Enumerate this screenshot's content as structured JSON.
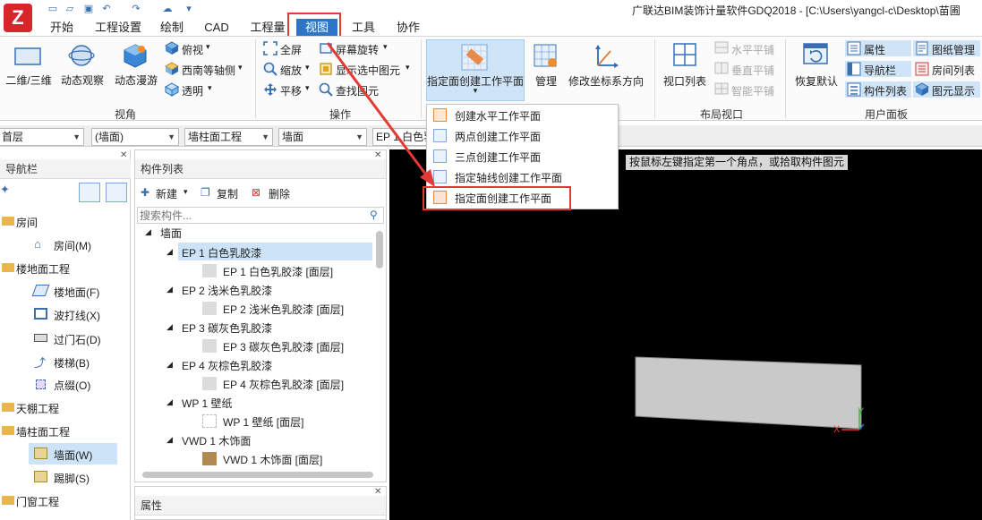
{
  "window": {
    "title": "广联达BIM装饰计量软件GDQ2018 - [C:\\Users\\yangcl-c\\Desktop\\苗圃"
  },
  "menu": {
    "logo": "Z",
    "tabs": [
      "开始",
      "工程设置",
      "绘制",
      "CAD",
      "工程量",
      "视图",
      "工具",
      "协作"
    ],
    "active_tab": "视图"
  },
  "ribbon": {
    "view_angle": {
      "group_label": "视角",
      "btn_2d3d": "二维/三维",
      "btn_dynamic_observe": "动态观察",
      "btn_dynamic_roam": "动态漫游",
      "btn_top_view": "俯视",
      "btn_southwest_axis": "西南等轴侧",
      "btn_transparent": "透明"
    },
    "operation": {
      "group_label": "操作",
      "btn_fullscreen": "全屏",
      "btn_zoom": "缩放",
      "btn_pan": "平移",
      "btn_screen_rotate": "屏幕旋转",
      "btn_show_selected": "显示选中图元",
      "btn_find_element": "查找图元"
    },
    "workplane": {
      "btn_face_workplane": "指定面创建工作平面",
      "btn_manage": "管理",
      "btn_modify_coord": "修改坐标系方向"
    },
    "layout_viewport": {
      "group_label": "布局视口",
      "btn_viewport_list": "视口列表",
      "btn_horizontal_tile": "水平平铺",
      "btn_vertical_tile": "垂直平铺",
      "btn_smart_tile": "智能平铺"
    },
    "user_panel": {
      "group_label": "用户面板",
      "btn_restore_default": "恢复默认",
      "btn_properties": "属性",
      "btn_navbar": "导航栏",
      "btn_component_list": "构件列表",
      "btn_drawing_manage": "图纸管理",
      "btn_room_list": "房间列表",
      "btn_element_display": "图元显示"
    }
  },
  "dropdown": {
    "items": [
      "创建水平工作平面",
      "两点创建工作平面",
      "三点创建工作平面",
      "指定轴线创建工作平面",
      "指定面创建工作平面"
    ],
    "selected": "指定面创建工作平面"
  },
  "combobar": {
    "floor": "首层",
    "category": "(墙面)",
    "project": "墙柱面工程",
    "type": "墙面",
    "component": "EP 1 白色乳"
  },
  "nav_panel": {
    "title": "导航栏",
    "groups": [
      {
        "label": "房间",
        "items": [
          "房间(M)"
        ]
      },
      {
        "label": "楼地面工程",
        "items": [
          "楼地面(F)",
          "波打线(X)",
          "过门石(D)",
          "楼梯(B)",
          "点缀(O)"
        ]
      },
      {
        "label": "天棚工程",
        "items": []
      },
      {
        "label": "墙柱面工程",
        "items": [
          "墙面(W)",
          "踢脚(S)"
        ]
      },
      {
        "label": "门窗工程",
        "items": []
      }
    ],
    "selected_item": "墙面(W)"
  },
  "comp_panel": {
    "title": "构件列表",
    "btn_new": "新建",
    "btn_copy": "复制",
    "btn_delete": "删除",
    "search_placeholder": "搜索构件...",
    "root": "墙面",
    "components": [
      {
        "name": "EP 1 白色乳胶漆",
        "child": "EP 1 白色乳胶漆 [面层]"
      },
      {
        "name": "EP 2 浅米色乳胶漆",
        "child": "EP 2 浅米色乳胶漆 [面层]"
      },
      {
        "name": "EP 3 碳灰色乳胶漆",
        "child": "EP 3 碳灰色乳胶漆 [面层]"
      },
      {
        "name": "EP 4 灰棕色乳胶漆",
        "child": "EP 4 灰棕色乳胶漆 [面层]"
      },
      {
        "name": "WP 1 壁纸",
        "child": "WP 1 壁纸 [面层]"
      },
      {
        "name": "VWD 1 木饰面",
        "child": "VWD 1 木饰面 [面层]"
      }
    ],
    "selected": "EP 1 白色乳胶漆"
  },
  "prop_panel": {
    "title": "属性"
  },
  "viewport": {
    "hint": "按鼠标左键指定第一个角点，或拾取构件图元",
    "axis_x": "X",
    "axis_y": "Y"
  },
  "colors": {
    "accent": "#2e75c5",
    "annotation_red": "#e53935",
    "selection": "#cde3f8"
  }
}
